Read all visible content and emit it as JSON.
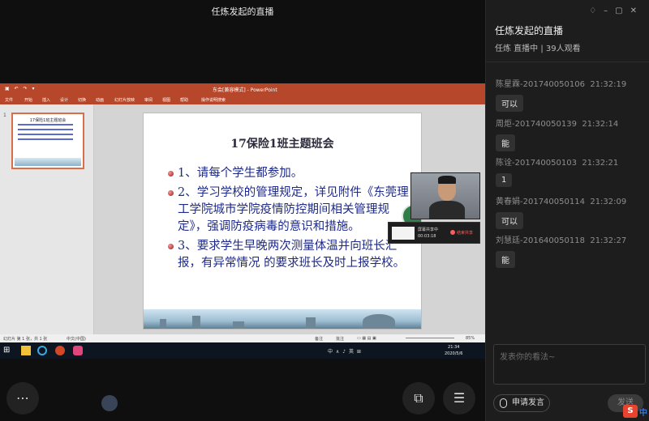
{
  "window": {
    "title": "任炼发起的直播"
  },
  "panel": {
    "title": "任炼发起的直播",
    "subtitle": "任炼 直播中 | 39人观看",
    "messages": [
      {
        "sender": "陈星霖-201740050106",
        "time": "21:32:19",
        "text": "可以"
      },
      {
        "sender": "周炬-201740050139",
        "time": "21:32:14",
        "text": "能"
      },
      {
        "sender": "陈诠-201740050103",
        "time": "21:32:21",
        "text": "1"
      },
      {
        "sender": "黄春娟-201740050114",
        "time": "21:32:09",
        "text": "可以"
      },
      {
        "sender": "刘慧廷-201640050118",
        "time": "21:32:27",
        "text": "能"
      }
    ],
    "input_placeholder": "发表你的看法~",
    "apply_label": "申请发言",
    "send_label": "发送"
  },
  "ppt": {
    "doc_title": "东会[兼容模式] - PowerPoint",
    "menu": [
      "文件",
      "开始",
      "插入",
      "设计",
      "切换",
      "动画",
      "幻灯片放映",
      "审阅",
      "视图",
      "帮助",
      "操作说明搜索"
    ],
    "slide": {
      "title": "17保险1班主题班会",
      "bullets": [
        "1、请每个学生都参加。",
        "2、学习学校的管理规定，详见附件《东莞理工学院城市学院疫情防控期间相关管理规定》，强调防疫病毒的意识和措施。",
        "3、要求学生早晚两次测量体温并向班长汇报，有异常情况 的要求班长及时上报学校。"
      ]
    },
    "thumb_num": "1",
    "status": {
      "slide_info": "幻灯片 第 1 张，共 1 张",
      "lang": "中文(中国)",
      "notes": "备注",
      "comments": "批注",
      "zoom": "85%"
    }
  },
  "recording": {
    "name": "屏幕共享中",
    "time": "00:03:18",
    "end_label": "结束共享"
  },
  "taskbar": {
    "time": "21:34",
    "date": "2020/5/6",
    "tray": "中 ∧ ♪ 英 ⊞"
  }
}
